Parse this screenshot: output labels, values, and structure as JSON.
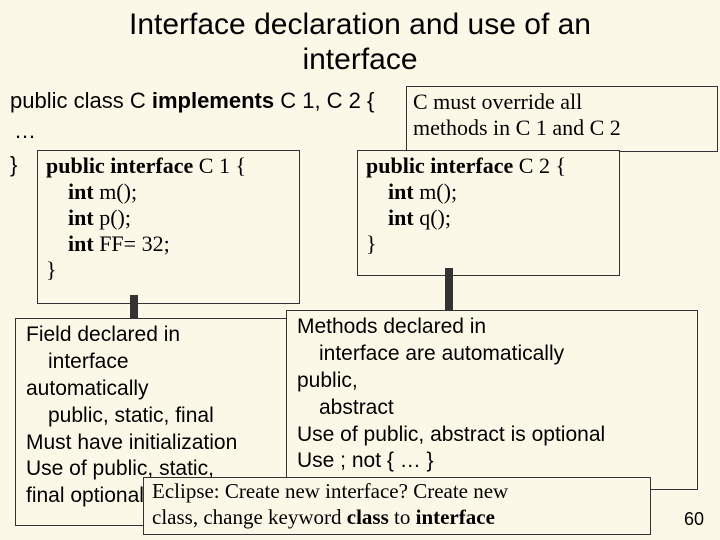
{
  "title_line1": "Interface declaration and use of an",
  "title_line2": "interface",
  "class_decl_pre": "public class C ",
  "class_decl_kw": "implements",
  "class_decl_post": " C 1, C 2 {",
  "dots": "…",
  "close": "}",
  "override_l1": "C must override all",
  "override_l2": "methods in C 1 and C 2",
  "c1": {
    "l1a": "public interface",
    "l1b": " C 1 {",
    "l2a": "int",
    "l2b": " m();",
    "l3a": "int",
    "l3b": " p();",
    "l4a": "int",
    "l4b": " FF= 32;",
    "l5": "}"
  },
  "c2": {
    "l1a": "public interface",
    "l1b": " C 2 {",
    "l2a": "int",
    "l2b": " m();",
    "l3a": "int",
    "l3b": " q();",
    "l4": "}"
  },
  "fieldbox": {
    "l1": "Field declared in",
    "l2": "interface",
    "l3": "automatically",
    "l4": "public, static, final",
    "l5": "Must have initialization",
    "l6": "Use of public, static,",
    "l7": "final  optional"
  },
  "methodbox": {
    "l1": "Methods declared in",
    "l2": "interface are automatically",
    "l3": "public,",
    "l4": "abstract",
    "l5": "Use of public, abstract  is optional",
    "l6": "Use   ;    not    {   …  }"
  },
  "eclipse_l1": "Eclipse: Create new interface? Create new",
  "eclipse_l2a": "class, change keyword ",
  "eclipse_l2b": "class",
  "eclipse_l2c": " to ",
  "eclipse_l2d": "interface",
  "slide": "60"
}
